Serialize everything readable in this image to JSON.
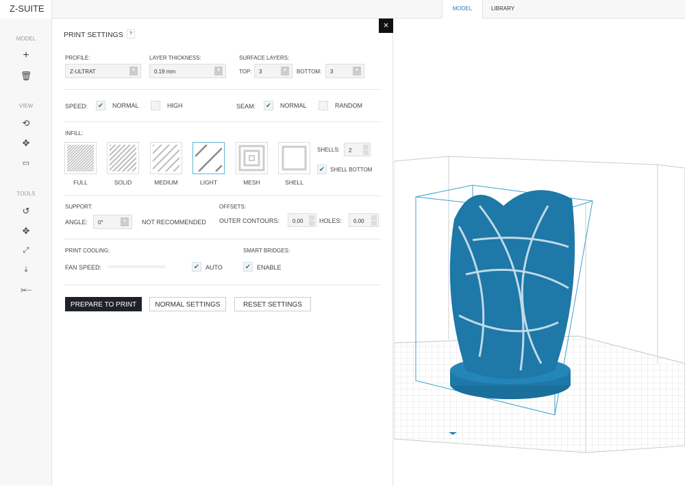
{
  "app": {
    "title": "Z-SUITE"
  },
  "tabs": [
    {
      "label": "MODEL",
      "active": true
    },
    {
      "label": "LIBRARY",
      "active": false
    }
  ],
  "sidebar": {
    "model_label": "MODEL",
    "view_label": "VIEW",
    "tools_label": "TOOLS",
    "icons": [
      "plus-icon",
      "trash-icon",
      "rotate-view-icon",
      "pan-icon",
      "camera-icon",
      "rotate-tool-icon",
      "move-tool-icon",
      "scale-tool-icon",
      "drop-to-bed-icon",
      "cut-icon"
    ]
  },
  "panel": {
    "title": "PRINT SETTINGS",
    "help": "?",
    "close": "×",
    "profile": {
      "label": "PROFILE:",
      "value": "Z-ULTRAT"
    },
    "layer": {
      "label": "LAYER THICKNESS:",
      "value": "0.19 mm"
    },
    "surface": {
      "label": "SURFACE LAYERS:",
      "top_label": "TOP:",
      "top_value": "3",
      "bottom_label": "BOTTOM:",
      "bottom_value": "3"
    },
    "speed": {
      "label": "SPEED:",
      "normal": "NORMAL",
      "normal_checked": true,
      "high": "HIGH",
      "high_checked": false
    },
    "seam": {
      "label": "SEAM:",
      "normal": "NORMAL",
      "normal_checked": true,
      "random": "RANDOM",
      "random_checked": false
    },
    "infill": {
      "label": "INFILL:",
      "options": [
        "FULL",
        "SOLID",
        "MEDIUM",
        "LIGHT",
        "MESH",
        "SHELL"
      ],
      "selected": "LIGHT",
      "shells_label": "SHELLS:",
      "shells_value": "2",
      "shell_bottom": "SHELL BOTTOM",
      "shell_bottom_checked": true
    },
    "support": {
      "label": "SUPPORT:",
      "angle_label": "ANGLE:",
      "angle_value": "0°",
      "note": "NOT RECOMMENDED"
    },
    "offsets": {
      "label": "OFFSETS:",
      "outer_label": "OUTER CONTOURS:",
      "outer_value": "0.00",
      "holes_label": "HOLES:",
      "holes_value": "0.00"
    },
    "cooling": {
      "label": "PRINT COOLING:",
      "fan_label": "FAN SPEED:",
      "auto": "AUTO",
      "auto_checked": true
    },
    "bridges": {
      "label": "SMART BRIDGES:",
      "enable": "ENABLE",
      "enable_checked": true
    },
    "buttons": {
      "prepare": "PREPARE TO PRINT",
      "normal": "NORMAL SETTINGS",
      "reset": "RESET SETTINGS"
    }
  },
  "colors": {
    "model": "#1e78a8",
    "accent": "#2a7fb0",
    "dark_button": "#1f2328"
  }
}
